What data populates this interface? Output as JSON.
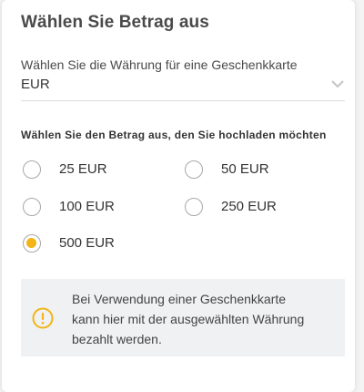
{
  "title": "Wählen Sie Betrag aus",
  "currency": {
    "label": "Wählen Sie die Währung für eine Geschenkkarte",
    "selected": "EUR",
    "icon": "chevron-down-icon"
  },
  "amount": {
    "label": "Wählen Sie den Betrag aus, den Sie hochladen möchten",
    "options": [
      {
        "label": "25 EUR",
        "checked": false
      },
      {
        "label": "50 EUR",
        "checked": false
      },
      {
        "label": "100 EUR",
        "checked": false
      },
      {
        "label": "250 EUR",
        "checked": false
      },
      {
        "label": "500 EUR",
        "checked": true
      }
    ]
  },
  "info": {
    "icon": "warning-circle-icon",
    "lines": [
      "Bei Verwendung einer Geschenkkarte",
      "kann hier mit der ausgewählten Währung",
      "bezahlt werden."
    ]
  },
  "colors": {
    "accent": "#f2b515",
    "info_background": "#f0f1f3",
    "text": "#333333"
  }
}
